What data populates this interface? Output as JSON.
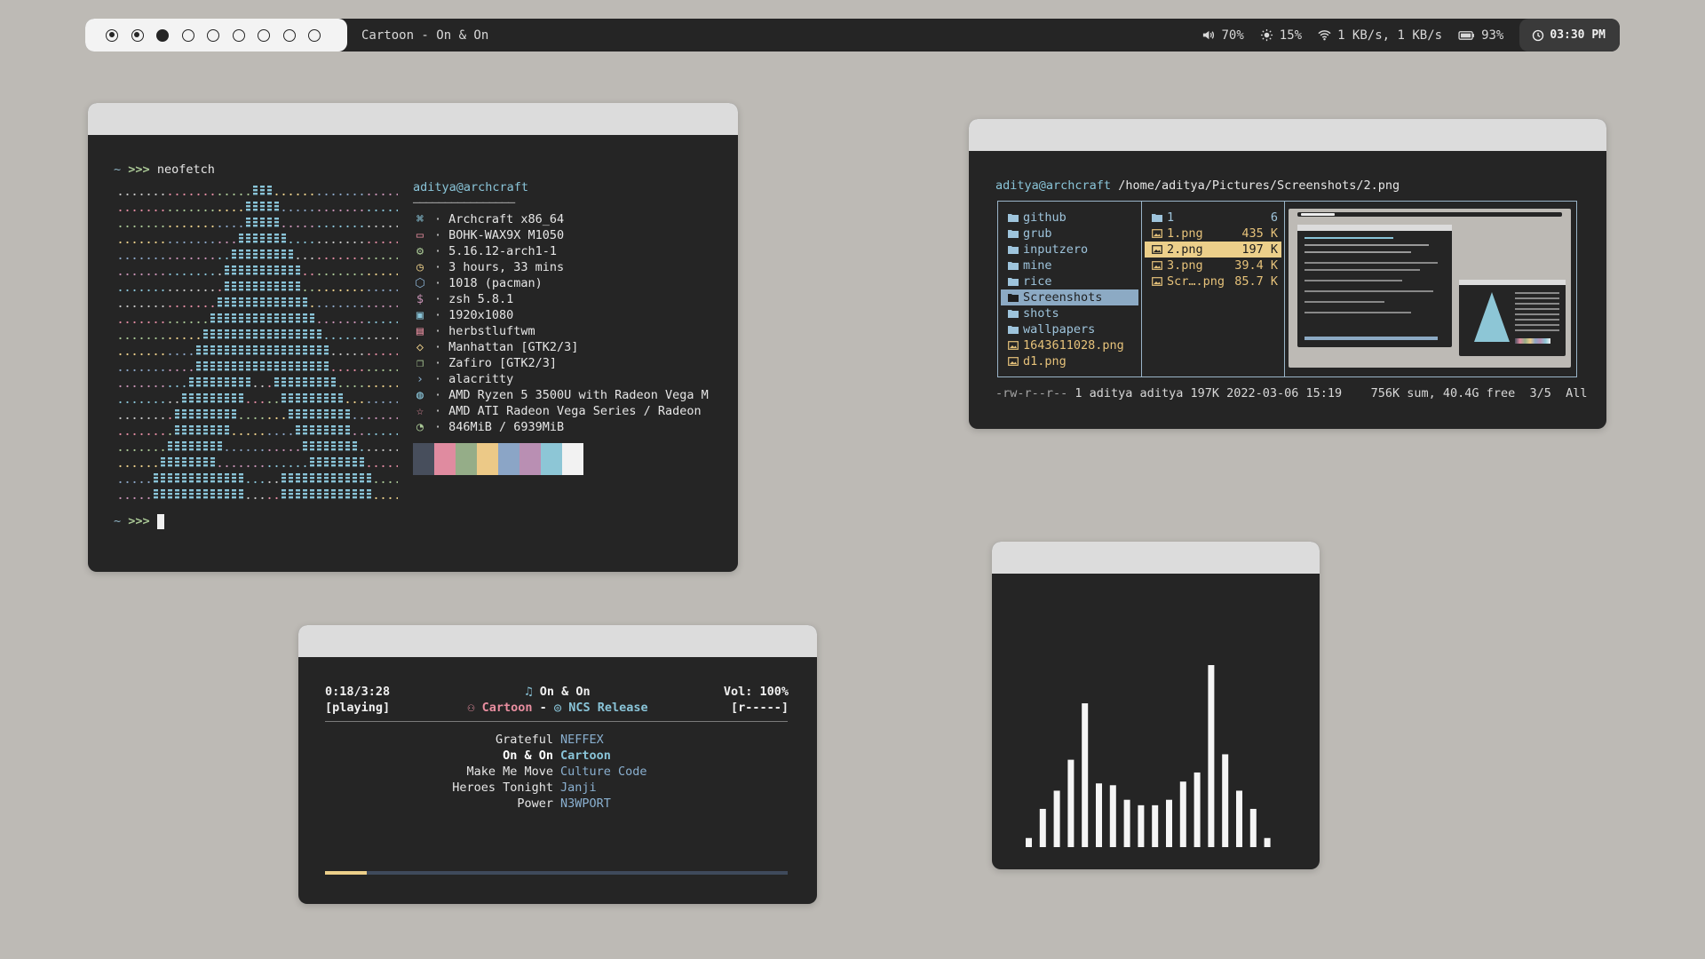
{
  "topbar": {
    "workspaces": [
      "occupied",
      "occupied",
      "active",
      "empty",
      "empty",
      "empty",
      "empty",
      "empty",
      "empty"
    ],
    "now_playing": "Cartoon - On & On",
    "volume": "70%",
    "brightness": "15%",
    "network": "1 KB/s, 1 KB/s",
    "battery": "93%",
    "clock": "03:30 PM"
  },
  "neofetch": {
    "command": "neofetch",
    "prompt_tilde": "~",
    "prompt_arrows": ">>>",
    "user_host": "aditya@archcraft",
    "separator": "────────────────",
    "rows": [
      {
        "icon": "cmd-icon",
        "color": "#89c4d8",
        "text": "Archcraft x86_64"
      },
      {
        "icon": "monitor-icon",
        "color": "#e88ea0",
        "text": "BOHK-WAX9X M1050"
      },
      {
        "icon": "gear-icon",
        "color": "#a9c795",
        "text": "5.16.12-arch1-1"
      },
      {
        "icon": "clock-icon",
        "color": "#eccf8a",
        "text": "3 hours, 33 mins"
      },
      {
        "icon": "package-icon",
        "color": "#8ab0d0",
        "text": "1018 (pacman)"
      },
      {
        "icon": "dollar-icon",
        "color": "#c892b4",
        "text": "zsh 5.8.1"
      },
      {
        "icon": "image-icon",
        "color": "#89c4d8",
        "text": "1920x1080"
      },
      {
        "icon": "window-icon",
        "color": "#e88ea0",
        "text": "herbstluftwm"
      },
      {
        "icon": "drop-icon",
        "color": "#eccf8a",
        "text": "Manhattan [GTK2/3]"
      },
      {
        "icon": "copy-icon",
        "color": "#a9c795",
        "text": "Zafiro [GTK2/3]"
      },
      {
        "icon": "terminal-icon",
        "color": "#8ab0d0",
        "text": "alacritty"
      },
      {
        "icon": "chip-icon",
        "color": "#89c4d8",
        "text": "AMD Ryzen 5 3500U with Radeon Vega M"
      },
      {
        "icon": "star-icon",
        "color": "#e88ea0",
        "text": "AMD ATI Radeon Vega Series / Radeon"
      },
      {
        "icon": "pie-icon",
        "color": "#a9c795",
        "text": "846MiB / 6939MiB"
      }
    ],
    "palette": [
      "#474e5c",
      "#e08ba0",
      "#95ad88",
      "#ecc987",
      "#8ba5c6",
      "#b98fb3",
      "#8dc6d6",
      "#f2f2f2"
    ]
  },
  "filemanager": {
    "user_host": "aditya@archcraft",
    "path": "/home/aditya/Pictures/Screenshots/2.png",
    "dirs": [
      "github",
      "grub",
      "inputzero",
      "mine",
      "rice",
      "Screenshots",
      "shots",
      "wallpapers"
    ],
    "dir_files": [
      "1643611028.png",
      "d1.png"
    ],
    "selected_dir": "Screenshots",
    "files": [
      {
        "name": "1",
        "size": "6",
        "type": "dir"
      },
      {
        "name": "1.png",
        "size": "435 K",
        "type": "img"
      },
      {
        "name": "2.png",
        "size": "197 K",
        "type": "selected"
      },
      {
        "name": "3.png",
        "size": "39.4 K",
        "type": "img"
      },
      {
        "name": "Scr….png",
        "size": "85.7 K",
        "type": "img"
      }
    ],
    "status_perm": "-rw-r--r--",
    "status_info": " 1 aditya aditya 197K 2022-03-06 15:19    756K sum, 40.4G free  3/5  All"
  },
  "music": {
    "time": "0:18/3:28",
    "state": "[playing]",
    "title": "On & On",
    "artist": "Cartoon",
    "dash": "-",
    "album": "NCS Release",
    "volume": "Vol: 100%",
    "flags": "[r-----]",
    "progress": 0.09,
    "playlist": [
      {
        "title": "Grateful",
        "artist": "NEFFEX",
        "current": false
      },
      {
        "title": "On & On",
        "artist": "Cartoon",
        "current": true
      },
      {
        "title": "Make Me Move",
        "artist": "Culture Code",
        "current": false
      },
      {
        "title": "Heroes Tonight",
        "artist": "Janji",
        "current": false
      },
      {
        "title": "Power",
        "artist": "N3WPORT",
        "current": false
      }
    ]
  },
  "visualizer": {
    "levels": [
      0.05,
      0.21,
      0.31,
      0.48,
      0.79,
      0.35,
      0.34,
      0.26,
      0.23,
      0.23,
      0.26,
      0.36,
      0.41,
      1.0,
      0.51,
      0.31,
      0.21,
      0.05
    ]
  }
}
